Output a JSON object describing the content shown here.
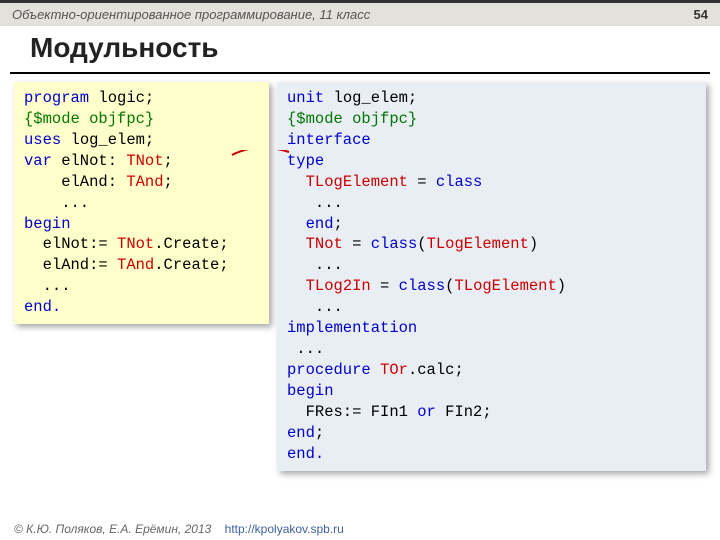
{
  "header": {
    "course": "Объектно-ориентированное программирование, 11 класс",
    "page": "54"
  },
  "title": "Модульность",
  "leftCode": {
    "l1a": "program",
    "l1b": " logic;",
    "l2a": "{$mode objfpc}",
    "l3a": "uses",
    "l3b": " log_elem;",
    "l4a": "var",
    "l4b": " elNot: ",
    "l4c": "TNot",
    "l4d": ";",
    "l5a": "    elAnd: ",
    "l5b": "TAnd",
    "l5c": ";",
    "l6a": "    ...",
    "l7a": "begin",
    "l8a": "  elNot:= ",
    "l8b": "TNot",
    "l8c": ".Create;",
    "l9a": "  elAnd:= ",
    "l9b": "TAnd",
    "l9c": ".Create;",
    "l10a": "  ...",
    "l11a": "end."
  },
  "rightCode": {
    "r1a": "unit",
    "r1b": " log_elem;",
    "r2a": "{$mode objfpc}",
    "r3a": "interface",
    "r4a": "type",
    "r5a": "  ",
    "r5b": "TLogElement",
    "r5c": " = ",
    "r5d": "class",
    "r6a": "   ...",
    "r7a": "  ",
    "r7b": "end",
    "r7c": ";",
    "r8a": "  ",
    "r8b": "TNot",
    "r8c": " = ",
    "r8d": "class",
    "r8e": "(",
    "r8f": "TLogElement",
    "r8g": ")",
    "r9a": "   ...",
    "r10a": "  ",
    "r10b": "TLog2In",
    "r10c": " = ",
    "r10d": "class",
    "r10e": "(",
    "r10f": "TLogElement",
    "r10g": ")",
    "r11a": "   ...",
    "r12a": "implementation",
    "r13a": " ...",
    "r14a": "procedure",
    "r14b": " ",
    "r14c": "TOr",
    "r14d": ".calc;",
    "r15a": "begin",
    "r16a": "  FRes:= FIn1 ",
    "r16b": "or",
    "r16c": " FIn2;",
    "r17a": "end",
    "r17b": ";",
    "r18a": "end."
  },
  "footer": {
    "copyright": "© К.Ю. Поляков, Е.А. Ерёмин, 2013",
    "url": "http://kpolyakov.spb.ru"
  }
}
